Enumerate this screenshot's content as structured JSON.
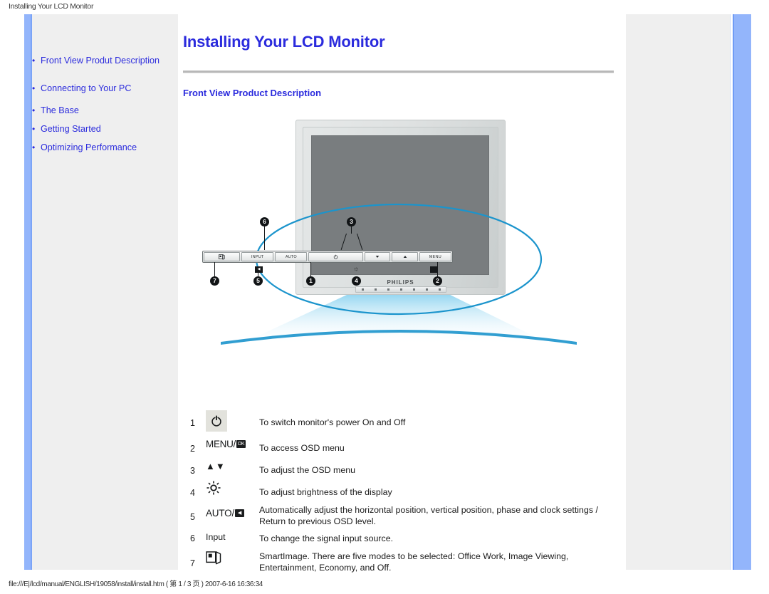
{
  "print_header": {
    "title": "Installing Your LCD Monitor"
  },
  "sidebar": {
    "items": [
      {
        "bullet": "•",
        "label": "Front View Produt Description"
      },
      {
        "bullet": "•",
        "label": "Connecting to Your PC"
      },
      {
        "bullet": "•",
        "label": "The Base"
      },
      {
        "bullet": "•",
        "label": "Getting Started"
      },
      {
        "bullet": "•",
        "label": "Optimizing Performance"
      }
    ]
  },
  "content": {
    "page_title": "Installing Your LCD Monitor",
    "section_title": "Front View Product Description"
  },
  "figure": {
    "monitor_brand": "PHILIPS",
    "panel_keys": [
      {
        "id": "smartimage",
        "label": ""
      },
      {
        "id": "input",
        "label": "INPUT"
      },
      {
        "id": "auto",
        "label": "AUTO"
      },
      {
        "id": "power",
        "label": ""
      },
      {
        "id": "down",
        "label": ""
      },
      {
        "id": "up",
        "label": ""
      },
      {
        "id": "menu",
        "label": "MENU"
      }
    ],
    "callout_numbers": [
      "1",
      "2",
      "3",
      "4",
      "5",
      "6",
      "7"
    ],
    "auto_sublabel": "◀",
    "menu_sublabel": "⬛"
  },
  "descriptions": {
    "rows": [
      {
        "num": "1",
        "icon": "power-icon",
        "icon_text": "⏻",
        "text": "To switch monitor's power On and Off"
      },
      {
        "num": "2",
        "icon": "menu-ok-icon",
        "icon_text": "MENU/",
        "icon_glyph": "OK",
        "text": "To access OSD menu"
      },
      {
        "num": "3",
        "icon": "up-down-arrows-icon",
        "icon_text": "▲▼",
        "text": "To adjust the OSD menu"
      },
      {
        "num": "4",
        "icon": "brightness-icon",
        "icon_text": "☼",
        "text": "To adjust brightness of the display"
      },
      {
        "num": "5",
        "icon": "auto-back-icon",
        "icon_text": "AUTO/",
        "icon_glyph": "◀",
        "text": "Automatically adjust the horizontal position, vertical position, phase and clock settings / Return to previous OSD level."
      },
      {
        "num": "6",
        "icon": "input-label",
        "icon_text": "Input",
        "text": "To change the signal input source."
      },
      {
        "num": "7",
        "icon": "smartimage-icon",
        "icon_text": "◰",
        "text": "SmartImage. There are five modes to be selected: Office Work, Image Viewing, Entertainment, Economy, and Off."
      }
    ]
  },
  "footer": {
    "text": "file:///E|/lcd/manual/ENGLISH/19058/install/install.htm ( 第 1 / 3 页 ) 2007-6-16 16:36:34"
  },
  "colors": {
    "link_blue": "#2b2bdd",
    "accent_blue": "#93b5fb",
    "callout_stroke": "#1b94cc",
    "panel_gray": "#efefef"
  }
}
